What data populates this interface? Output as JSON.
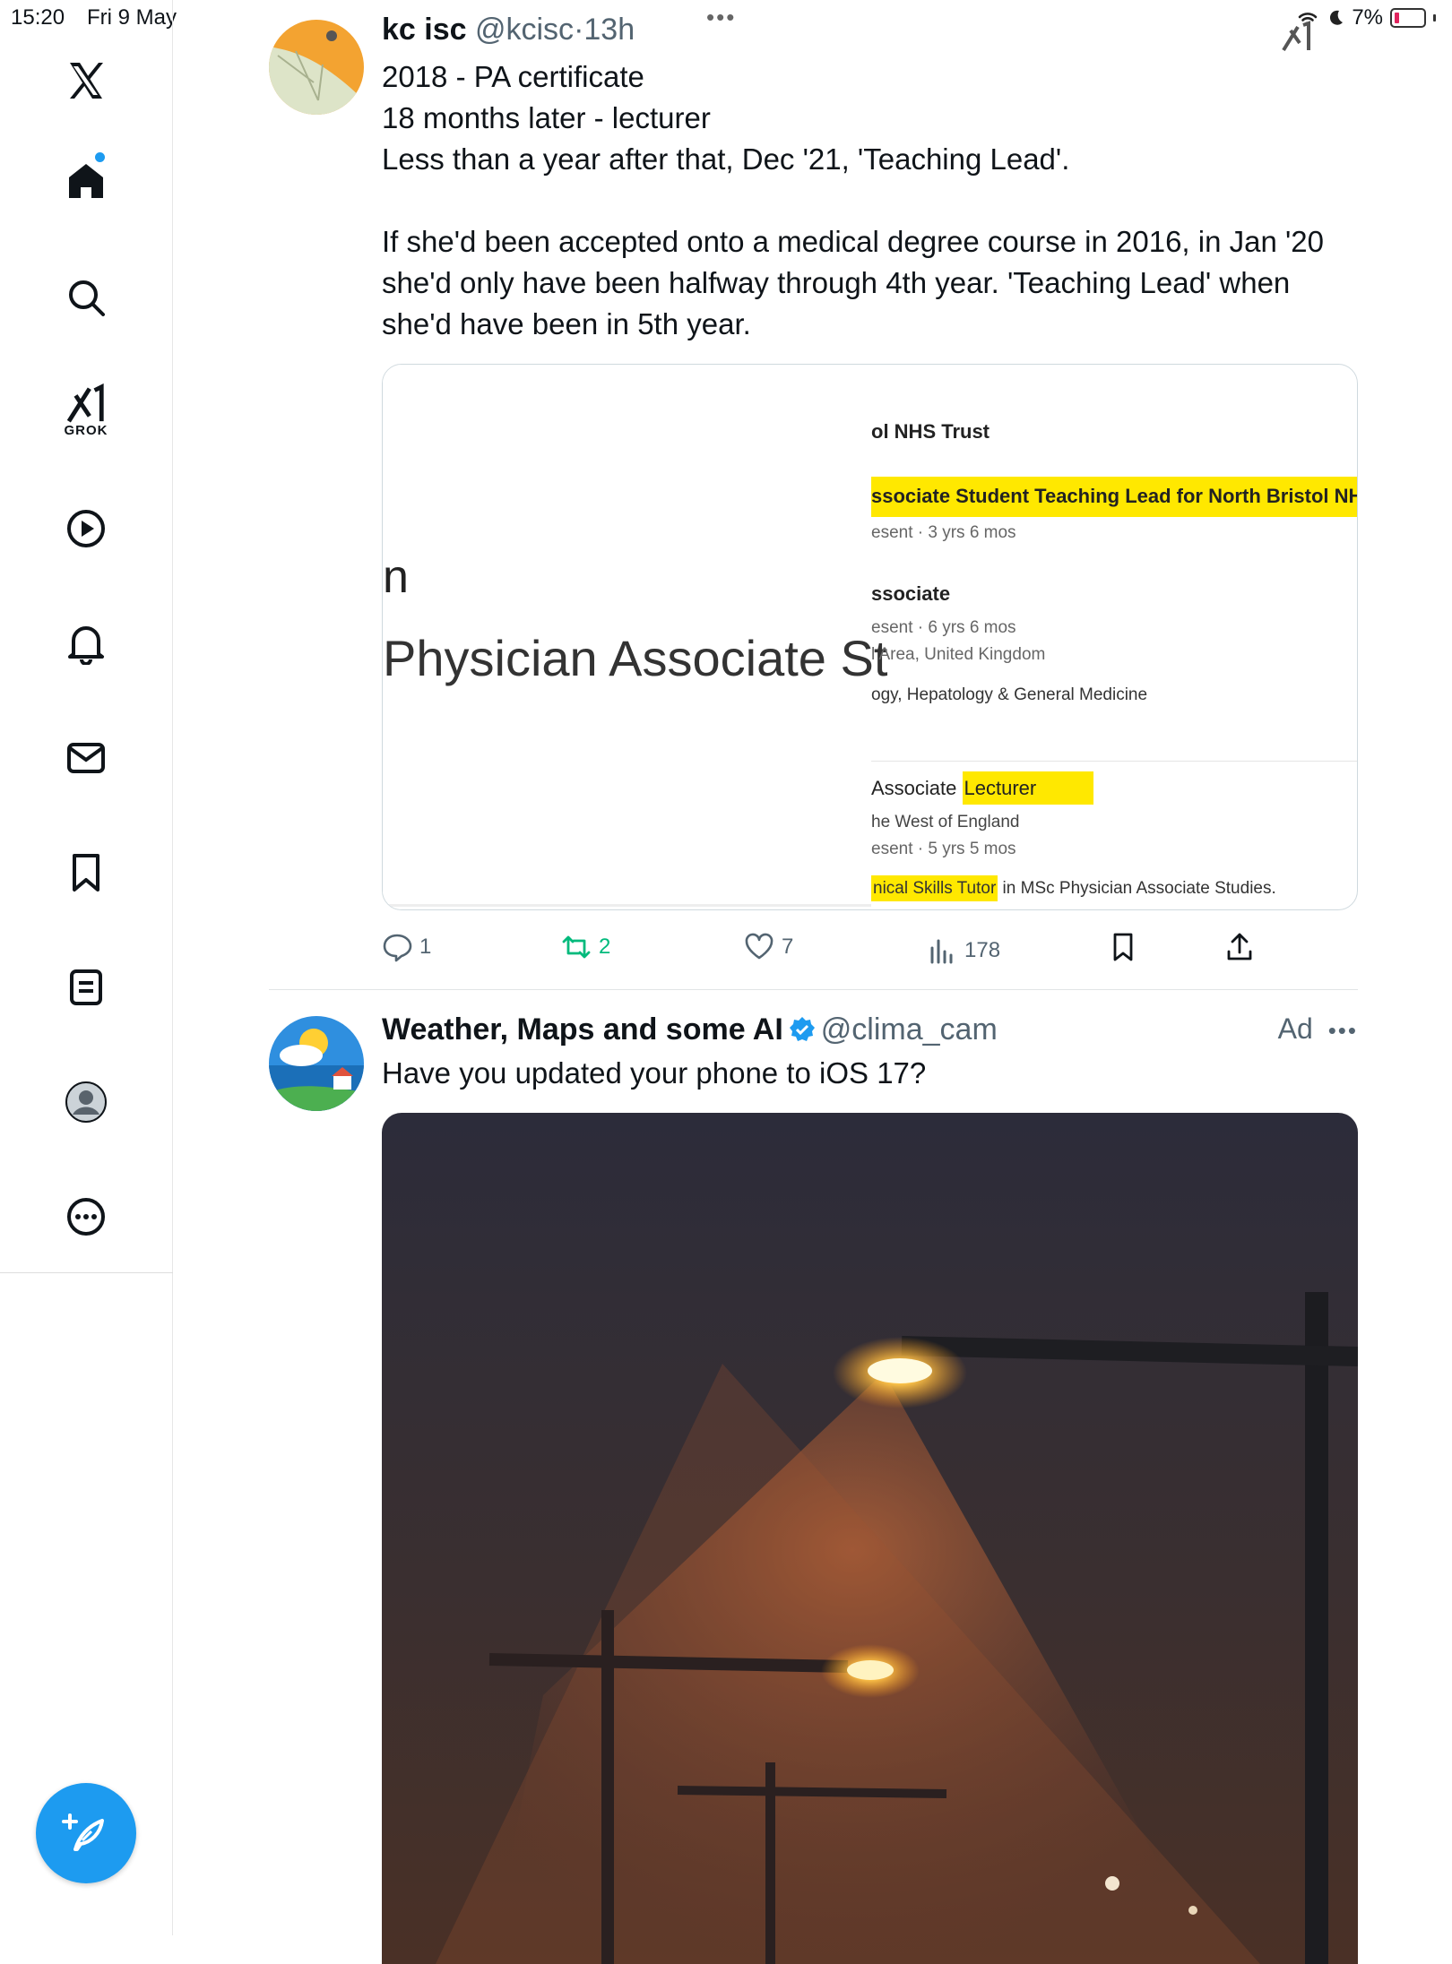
{
  "status_bar": {
    "time": "15:20",
    "date": "Fri 9 May",
    "battery": "7%"
  },
  "sidebar": {
    "items": [
      {
        "name": "x-logo-icon"
      },
      {
        "name": "home-icon"
      },
      {
        "name": "search-icon"
      },
      {
        "name": "grok-icon",
        "label": "GROK"
      },
      {
        "name": "video-icon"
      },
      {
        "name": "notifications-icon"
      },
      {
        "name": "messages-icon"
      },
      {
        "name": "bookmarks-icon"
      },
      {
        "name": "lists-icon"
      },
      {
        "name": "profile-icon"
      },
      {
        "name": "more-icon"
      }
    ],
    "compose_icon": "compose-icon"
  },
  "tweet1": {
    "name": "kc isc",
    "handle": "@kcisc",
    "time": "13h",
    "text": "2018 - PA certificate\n18 months later - lecturer\nLess than a year after that, Dec '21, 'Teaching Lead'.\n\nIf she'd been accepted onto a medical degree course in 2016, in Jan '20 she'd only have been halfway through 4th year. 'Teaching Lead' when she'd have been in 5th year.",
    "media": {
      "left_small": "n",
      "left_large": "Physician Associate St",
      "org": "ol NHS Trust",
      "role1": "ssociate Student Teaching Lead for North Bristol NH",
      "role1_dur": "esent · 3 yrs 6 mos",
      "role2": "ssociate",
      "role2_dur": "esent · 6 yrs 6 mos",
      "role2_loc": "l Area, United Kingdom",
      "role2_dept": "ogy, Hepatology & General Medicine",
      "role3_prefix": "Associate ",
      "role3_hl": "Lecturer",
      "role3_org": "he West of England",
      "role3_dur": "esent · 5 yrs 5 mos",
      "role3_desc_hl": "nical Skills Tutor",
      "role3_desc": " in MSc Physician Associate Studies."
    },
    "replies": "1",
    "reposts": "2",
    "likes": "7",
    "views": "178",
    "accent_repost": "#00ba7c"
  },
  "tweet2": {
    "name": "Weather, Maps and some AI",
    "handle": "@clima_cam",
    "ad_label": "Ad",
    "text": "Have you updated your phone to iOS 17?"
  },
  "colors": {
    "accent": "#1d9bf0",
    "highlight": "#ffe800"
  }
}
